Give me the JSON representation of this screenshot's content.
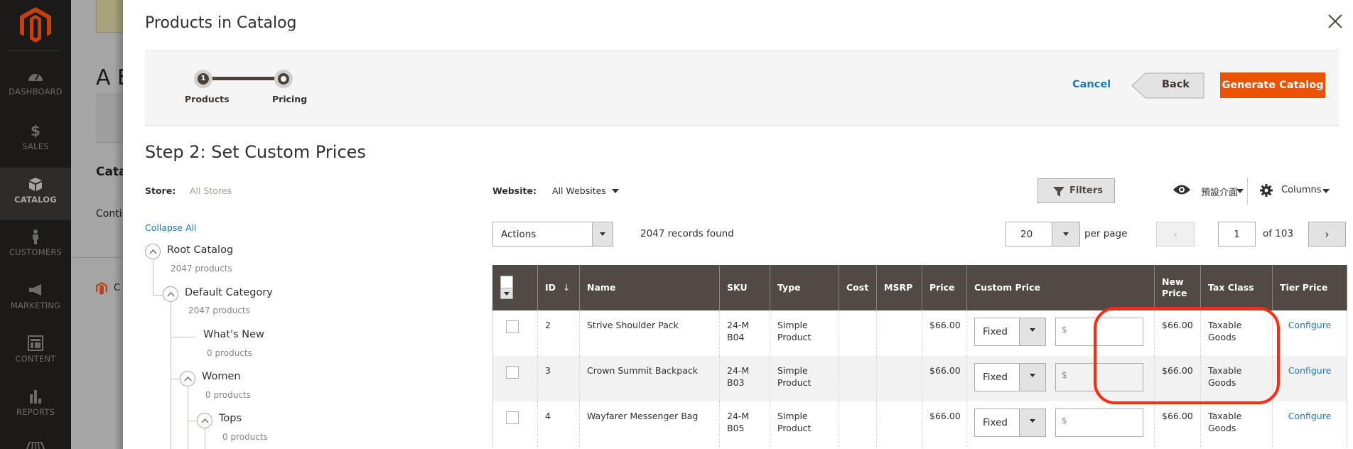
{
  "sidebar": {
    "logo": "magento-logo",
    "items": [
      {
        "label": "DASHBOARD",
        "icon": "dashboard-gauge-icon",
        "active": false
      },
      {
        "label": "SALES",
        "icon": "dollar-icon",
        "active": false
      },
      {
        "label": "CATALOG",
        "icon": "box-icon",
        "active": true
      },
      {
        "label": "CUSTOMERS",
        "icon": "person-icon",
        "active": false
      },
      {
        "label": "MARKETING",
        "icon": "megaphone-icon",
        "active": false
      },
      {
        "label": "CONTENT",
        "icon": "layout-icon",
        "active": false
      },
      {
        "label": "REPORTS",
        "icon": "bar-chart-icon",
        "active": false
      }
    ]
  },
  "background_page": {
    "title_fragment": "A E",
    "section_fragment": "Cata",
    "text_fragment": "Contir",
    "footer_fragment": "C"
  },
  "modal": {
    "title": "Products in Catalog",
    "close_icon": "close-icon",
    "steps": [
      {
        "number": "1",
        "label": "Products",
        "state": "complete"
      },
      {
        "number": "",
        "label": "Pricing",
        "state": "current"
      }
    ],
    "actions": {
      "cancel": "Cancel",
      "back": "Back",
      "generate": "Generate Catalog"
    },
    "step_title": "Step 2: Set Custom Prices",
    "store": {
      "label": "Store:",
      "value": "All Stores"
    },
    "collapse_all": "Collapse All",
    "tree": [
      {
        "name": "Root Catalog",
        "count": "2047 products",
        "level": 0,
        "expandable": true
      },
      {
        "name": "Default Category",
        "count": "2047 products",
        "level": 1,
        "expandable": true
      },
      {
        "name": "What's New",
        "count": "0 products",
        "level": 2,
        "expandable": false
      },
      {
        "name": "Women",
        "count": "0 products",
        "level": 2,
        "expandable": true
      },
      {
        "name": "Tops",
        "count": "0 products",
        "level": 3,
        "expandable": true
      }
    ]
  },
  "grid": {
    "website": {
      "label": "Website:",
      "value": "All Websites"
    },
    "filters_label": "Filters",
    "view_label": "預設介面",
    "columns_label": "Columns",
    "actions_label": "Actions",
    "records_found": "2047 records found",
    "per_page_value": "20",
    "per_page_label": "per page",
    "current_page": "1",
    "page_of": "of 103",
    "prev_glyph": "‹",
    "next_glyph": "›",
    "sort_indicator": "↓",
    "columns": [
      "ID",
      "Name",
      "SKU",
      "Type",
      "Cost",
      "MSRP",
      "Price",
      "Custom Price",
      "New Price",
      "Tax Class",
      "Tier Price"
    ],
    "rows": [
      {
        "id": "2",
        "name": "Strive Shoulder Pack",
        "sku": "24-MB04",
        "type": "Simple Product",
        "cost": "",
        "msrp": "",
        "price": "$66.00",
        "custom_price_type": "Fixed",
        "custom_price_placeholder": "$",
        "new_price": "$66.00",
        "tax_class": "Taxable Goods",
        "tier_price": "Configure"
      },
      {
        "id": "3",
        "name": "Crown Summit Backpack",
        "sku": "24-MB03",
        "type": "Simple Product",
        "cost": "",
        "msrp": "",
        "price": "$66.00",
        "custom_price_type": "Fixed",
        "custom_price_placeholder": "$",
        "new_price": "$66.00",
        "tax_class": "Taxable Goods",
        "tier_price": "Configure"
      },
      {
        "id": "4",
        "name": "Wayfarer Messenger Bag",
        "sku": "24-MB05",
        "type": "Simple Product",
        "cost": "",
        "msrp": "",
        "price": "$66.00",
        "custom_price_type": "Fixed",
        "custom_price_placeholder": "$",
        "new_price": "$66.00",
        "tax_class": "Taxable Goods",
        "tier_price": "Configure"
      }
    ]
  },
  "colors": {
    "accent": "#eb5202",
    "link": "#1979c3",
    "header_bg": "#514943",
    "annotation": "#ff2a10"
  }
}
